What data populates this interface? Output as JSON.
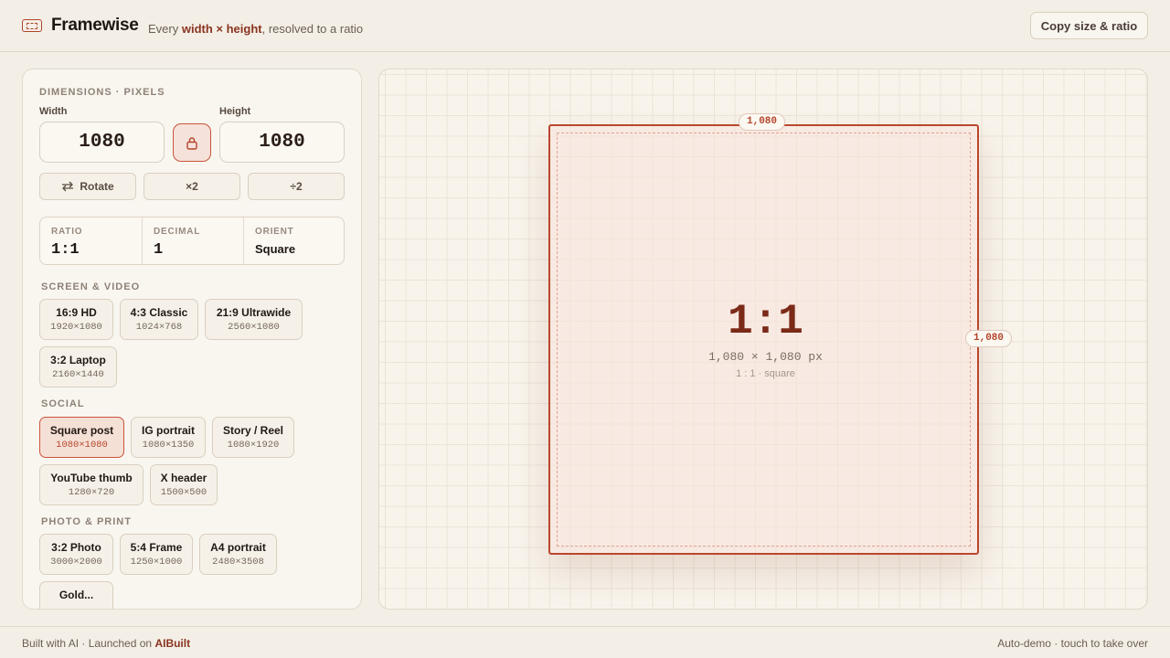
{
  "header": {
    "brand": "Framewise",
    "tagline_prefix": "Every ",
    "tagline_emph": "width × height",
    "tagline_suffix": ", resolved to a ratio",
    "copy_button": "Copy size & ratio"
  },
  "dimensions": {
    "section_title": "Dimensions · Pixels",
    "width_label": "Width",
    "height_label": "Height",
    "width_value": "1080",
    "height_value": "1080",
    "lock_icon": "lock-icon",
    "rotate_label": "Rotate",
    "double_label": "×2",
    "half_label": "÷2"
  },
  "stats": {
    "ratio_label": "RATIO",
    "ratio_value": "1:1",
    "decimal_label": "DECIMAL",
    "decimal_value": "1",
    "orient_label": "ORIENT",
    "orient_value": "Square"
  },
  "presets": {
    "screen_title": "Screen & Video",
    "screen": [
      {
        "name": "16:9 HD",
        "size": "1920×1080"
      },
      {
        "name": "4:3 Classic",
        "size": "1024×768"
      },
      {
        "name": "21:9 Ultrawide",
        "size": "2560×1080"
      },
      {
        "name": "3:2 Laptop",
        "size": "2160×1440"
      }
    ],
    "social_title": "Social",
    "social": [
      {
        "name": "Square post",
        "size": "1080×1080",
        "active": true
      },
      {
        "name": "IG portrait",
        "size": "1080×1350"
      },
      {
        "name": "Story / Reel",
        "size": "1080×1920"
      },
      {
        "name": "YouTube thumb",
        "size": "1280×720"
      },
      {
        "name": "X header",
        "size": "1500×500"
      }
    ],
    "photo_title": "Photo & Print",
    "photo": [
      {
        "name": "3:2 Photo",
        "size": "3000×2000"
      },
      {
        "name": "5:4 Frame",
        "size": "1250×1000"
      },
      {
        "name": "A4 portrait",
        "size": "2480×3508"
      },
      {
        "name": "Gold...",
        "size": ""
      }
    ]
  },
  "canvas": {
    "top_tag": "1,080",
    "side_tag": "1,080",
    "ratio": "1:1",
    "pixels": "1,080 × 1,080 px",
    "sub": "1 : 1 · square"
  },
  "footer": {
    "left_text": "Built with AI · Launched on ",
    "left_link": "AIBuilt",
    "right_text": "Auto-demo · touch to take over"
  },
  "colors": {
    "accent": "#b5452b",
    "background": "#f3efe6",
    "panel": "#f9f6f0"
  }
}
